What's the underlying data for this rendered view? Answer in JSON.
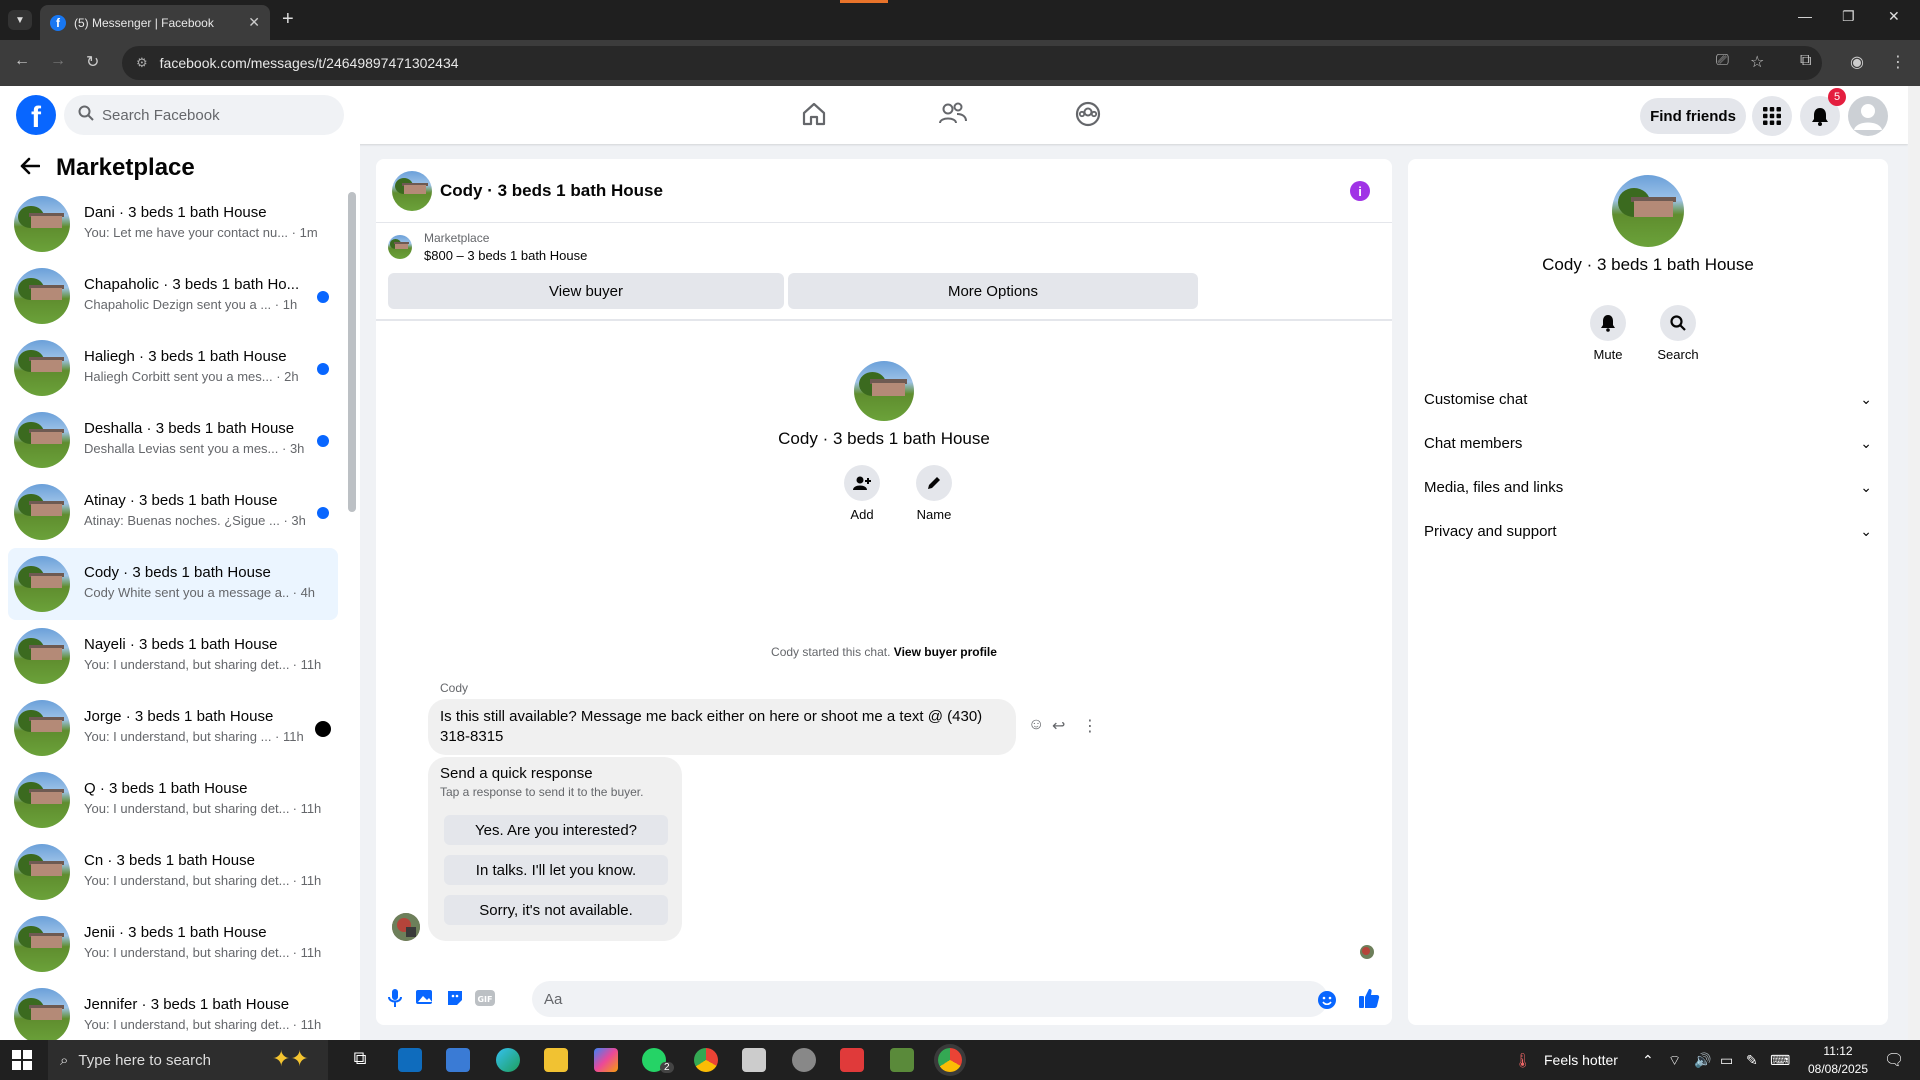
{
  "browser": {
    "tab_title": "(5) Messenger | Facebook",
    "url": "facebook.com/messages/t/24649897471302434"
  },
  "header": {
    "search_placeholder": "Search Facebook",
    "find_friends": "Find friends",
    "notification_count": "5"
  },
  "sidebar": {
    "title": "Marketplace",
    "conversations": [
      {
        "name": "Dani · 3 beds 1 bath House",
        "snippet": "You: Let me have your contact nu...",
        "time": "1m",
        "unread": false
      },
      {
        "name": "Chapaholic · 3 beds 1 bath Ho...",
        "snippet": "Chapaholic Dezign sent you a ...",
        "time": "1h",
        "unread": true
      },
      {
        "name": "Haliegh · 3 beds 1 bath House",
        "snippet": "Haliegh Corbitt sent you a mes...",
        "time": "2h",
        "unread": true
      },
      {
        "name": "Deshalla · 3 beds 1 bath House",
        "snippet": "Deshalla Levias sent you a mes...",
        "time": "3h",
        "unread": true
      },
      {
        "name": "Atinay · 3 beds 1 bath House",
        "snippet": "Atinay: Buenas noches. ¿Sigue ...",
        "time": "3h",
        "unread": true
      },
      {
        "name": "Cody · 3 beds 1 bath House",
        "snippet": "Cody White sent you a message a...",
        "time": "4h",
        "unread": false
      },
      {
        "name": "Nayeli · 3 beds 1 bath House",
        "snippet": "You: I understand, but sharing det...",
        "time": "11h",
        "unread": false
      },
      {
        "name": "Jorge · 3 beds 1 bath House",
        "snippet": "You: I understand, but sharing ...",
        "time": "11h",
        "unread": false
      },
      {
        "name": "Q · 3 beds 1 bath House",
        "snippet": "You: I understand, but sharing det...",
        "time": "11h",
        "unread": false
      },
      {
        "name": "Cn · 3 beds 1 bath House",
        "snippet": "You: I understand, but sharing det...",
        "time": "11h",
        "unread": false
      },
      {
        "name": "Jenii · 3 beds 1 bath House",
        "snippet": "You: I understand, but sharing det...",
        "time": "11h",
        "unread": false
      },
      {
        "name": "Jennifer · 3 beds 1 bath House",
        "snippet": "You: I understand, but sharing det...",
        "time": "11h",
        "unread": false
      }
    ]
  },
  "chat": {
    "title": "Cody · 3 beds 1 bath House",
    "marketplace_label": "Marketplace",
    "listing": "$800 – 3 beds 1 bath House",
    "view_buyer": "View buyer",
    "more_options": "More Options",
    "intro_name": "Cody · 3 beds 1 bath House",
    "add_label": "Add",
    "name_label": "Name",
    "started_text": "Cody started this chat.",
    "view_buyer_profile": "View buyer profile",
    "sender": "Cody",
    "message": "Is this still available? Message me back either on here or shoot me a text @ (430) 318-8315",
    "quick_title": "Send a quick response",
    "quick_sub": "Tap a response to send it to the buyer.",
    "quick_replies": [
      "Yes. Are you interested?",
      "In talks. I'll let you know.",
      "Sorry, it's not available."
    ],
    "composer_placeholder": "Aa"
  },
  "info_panel": {
    "name": "Cody · 3 beds 1 bath House",
    "mute": "Mute",
    "search": "Search",
    "sections": [
      "Customise chat",
      "Chat members",
      "Media, files and links",
      "Privacy and support"
    ]
  },
  "taskbar": {
    "search_placeholder": "Type here to search",
    "weather": "Feels hotter",
    "time": "11:12",
    "date": "08/08/2025",
    "whatsapp_badge": "2"
  },
  "colors": {
    "accent": "#0866ff",
    "unread_dot": "#0866ff",
    "badge": "#e41e3f",
    "info_icon": "#a033e6"
  }
}
